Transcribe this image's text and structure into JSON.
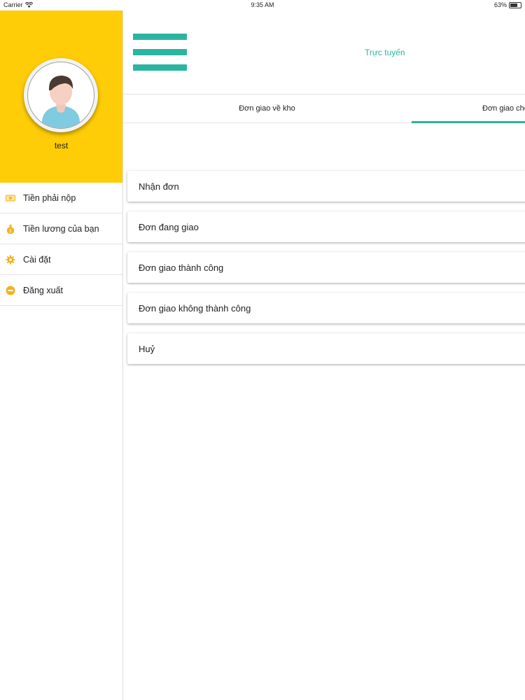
{
  "status_bar": {
    "carrier": "Carrier",
    "time": "9:35 AM",
    "battery": "63%"
  },
  "drawer": {
    "username": "test",
    "items": [
      {
        "label": "Tiền phải nộp",
        "icon": "money-icon"
      },
      {
        "label": "Tiền lương của bạn",
        "icon": "money-bag-icon"
      },
      {
        "label": "Cài đặt",
        "icon": "gear-icon"
      },
      {
        "label": "Đăng xuất",
        "icon": "logout-icon"
      }
    ]
  },
  "header": {
    "status": "Trực tuyến"
  },
  "tabs": [
    {
      "label": "Đơn giao về kho"
    },
    {
      "label": "Đơn giao che"
    }
  ],
  "orders": [
    {
      "label": "Nhận đơn"
    },
    {
      "label": "Đơn đang giao"
    },
    {
      "label": "Đơn giao thành công"
    },
    {
      "label": "Đơn giao không thành công"
    },
    {
      "label": "Huỷ"
    }
  ],
  "colors": {
    "accent": "#2bb5a0",
    "drawer_header": "#fecd07",
    "icon": "#f4b31b"
  }
}
